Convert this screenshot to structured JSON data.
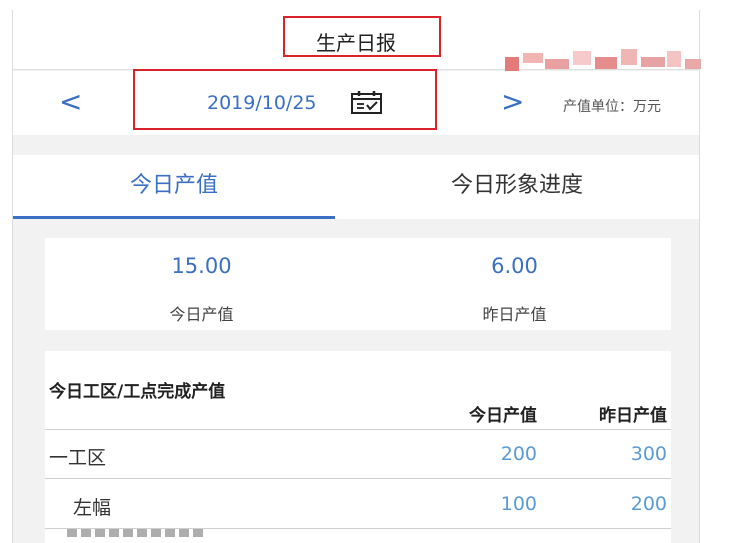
{
  "header": {
    "title": "生产日报"
  },
  "date_bar": {
    "prev_label": "<",
    "next_label": ">",
    "date": "2019/10/25",
    "unit": "产值单位：万元"
  },
  "tabs": [
    {
      "label": "今日产值",
      "active": true
    },
    {
      "label": "今日形象进度",
      "active": false
    }
  ],
  "summary": [
    {
      "value": "15.00",
      "label": "今日产值"
    },
    {
      "value": "6.00",
      "label": "昨日产值"
    }
  ],
  "table": {
    "title": "今日工区/工点完成产值",
    "columns": [
      "今日产值",
      "昨日产值"
    ],
    "rows": [
      {
        "name": "一工区",
        "today": "200",
        "yesterday": "300",
        "indent": false
      },
      {
        "name": "左幅",
        "today": "100",
        "yesterday": "200",
        "indent": true
      }
    ]
  },
  "colors": {
    "accent": "#3a6fc4",
    "value_blue": "#5b9bd5",
    "highlight_red": "#d9222a"
  },
  "icons": {
    "calendar": "calendar-check-icon"
  }
}
